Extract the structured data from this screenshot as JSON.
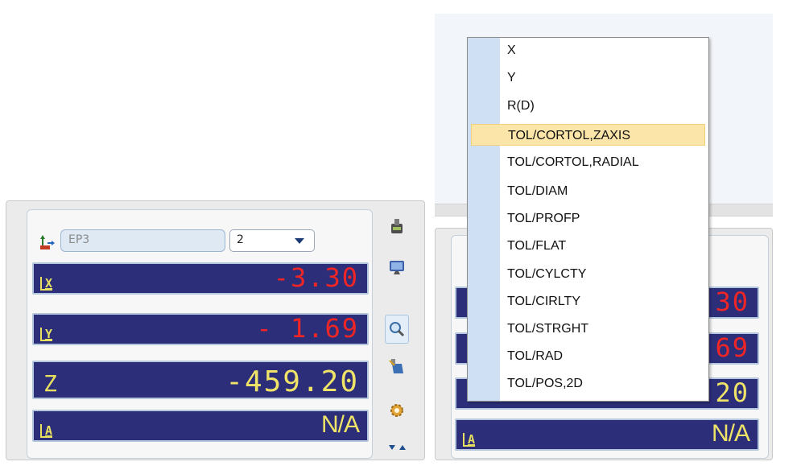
{
  "left_panel": {
    "id_field": "EP3",
    "selector": {
      "value": "2"
    },
    "readouts": [
      {
        "label": "X",
        "value": "-3.30",
        "color": "#f02525"
      },
      {
        "label": "Y",
        "value": "- 1.69",
        "color": "#f02525"
      },
      {
        "label": "Z",
        "value": "-459.20",
        "color": "#efe468"
      },
      {
        "label": "A",
        "value": "N/A",
        "color": "#efe468"
      }
    ],
    "toolbar": [
      "probe-icon",
      "monitor-icon",
      "magnify-icon",
      "camera-icon",
      "settings-icon",
      "expand-collapse-icon"
    ]
  },
  "right_panel": {
    "visible_readouts": [
      {
        "value": "30"
      },
      {
        "value": "69"
      },
      {
        "value": "20"
      },
      {
        "label": "A",
        "value": "N/A"
      }
    ]
  },
  "dropdown_menu": {
    "items": [
      "X",
      "Y",
      "R(D)",
      "TOL/CORTOL,ZAXIS",
      "TOL/CORTOL,RADIAL",
      "TOL/DIAM",
      "TOL/PROFP",
      "TOL/FLAT",
      "TOL/CYLCTY",
      "TOL/CIRLTY",
      "TOL/STRGHT",
      "TOL/RAD",
      "TOL/POS,2D"
    ],
    "highlighted_index": 3,
    "highlight_color": "#fbe5a8",
    "gutter_color": "#cfe0f4"
  },
  "colors": {
    "readout_bg": "#2c2e7a",
    "readout_label": "#e8e060",
    "negative_value": "#f02525"
  }
}
